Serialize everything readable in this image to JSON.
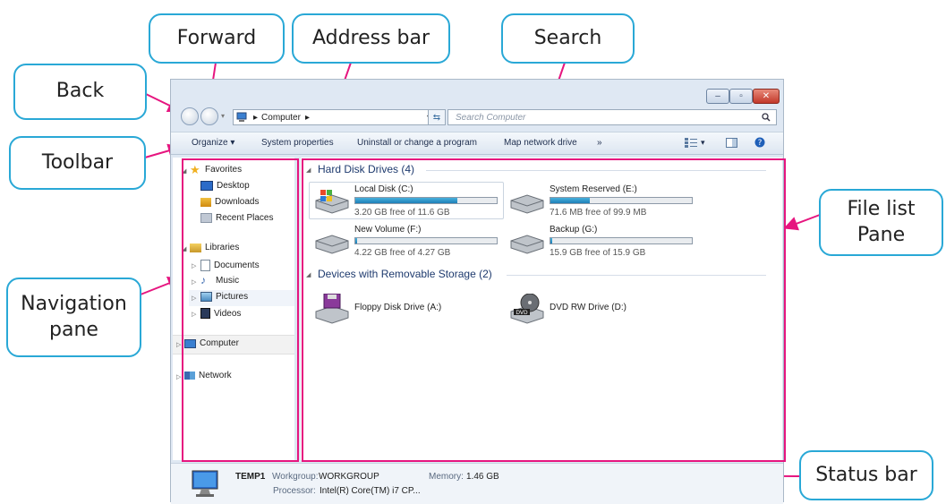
{
  "callouts": {
    "forward": "Forward",
    "address_bar": "Address bar",
    "search": "Search",
    "back": "Back",
    "toolbar": "Toolbar",
    "navigation_pane_line1": "Navigation",
    "navigation_pane_line2": "pane",
    "file_list_line1": "File list",
    "file_list_line2": "Pane",
    "status_bar": "Status bar"
  },
  "window": {
    "address": {
      "icon": "computer-icon",
      "sep1": "▸",
      "location": "Computer",
      "sep2": "▸",
      "dropdown": "▾",
      "refresh": "⇆"
    },
    "search": {
      "placeholder": "Search Computer",
      "icon": "magnifier-icon"
    },
    "controls": {
      "minimize": "–",
      "maximize": "▫",
      "close": "✕"
    }
  },
  "toolbar": {
    "organize": "Organize ▾",
    "system_properties": "System properties",
    "uninstall": "Uninstall or change a program",
    "map_drive": "Map network drive",
    "more": "»",
    "view_icon": "▾"
  },
  "navigation": {
    "favorites": "Favorites",
    "desktop": "Desktop",
    "downloads": "Downloads",
    "recent_places": "Recent Places",
    "libraries": "Libraries",
    "documents": "Documents",
    "music": "Music",
    "pictures": "Pictures",
    "videos": "Videos",
    "computer": "Computer",
    "network": "Network"
  },
  "file_list": {
    "hard_disk_header": "Hard Disk Drives (4)",
    "removable_header": "Devices with Removable Storage (2)",
    "drives": [
      {
        "name": "Local Disk (C:)",
        "free": "3.20 GB free of 11.6 GB",
        "used_fraction": 0.72
      },
      {
        "name": "System Reserved (E:)",
        "free": "71.6 MB free of 99.9 MB",
        "used_fraction": 0.28
      },
      {
        "name": "New Volume (F:)",
        "free": "4.22 GB free of 4.27 GB",
        "used_fraction": 0.01
      },
      {
        "name": "Backup (G:)",
        "free": "15.9 GB free of 15.9 GB",
        "used_fraction": 0.01
      }
    ],
    "removable": [
      {
        "name": "Floppy Disk Drive (A:)"
      },
      {
        "name": "DVD RW Drive (D:)",
        "badge": "DVD"
      }
    ]
  },
  "status": {
    "computer_name": "TEMP1",
    "workgroup_label": "Workgroup:",
    "workgroup_value": "WORKGROUP",
    "memory_label": "Memory:",
    "memory_value": "1.46 GB",
    "processor_label": "Processor:",
    "processor_value": "Intel(R) Core(TM) i7 CP..."
  },
  "colors": {
    "callout_border": "#29a8d6",
    "highlight": "#e6157f",
    "usage_bar": "#2a8fc8"
  }
}
